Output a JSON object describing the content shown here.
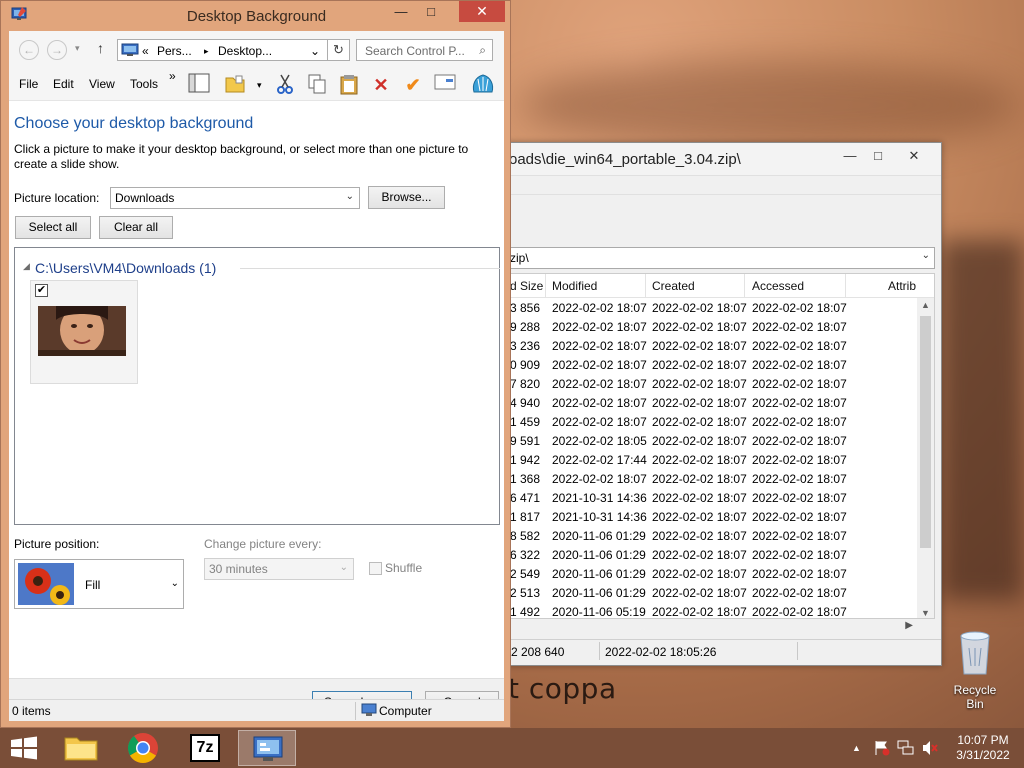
{
  "main_window": {
    "title": "Desktop Background",
    "controls": {
      "minimize": "—",
      "maximize": "□",
      "close": "✕"
    },
    "nav": {
      "back": "←",
      "forward": "→",
      "dropdown": "▾",
      "up": "↑",
      "breadcrumb_prefix": "«",
      "crumb_1": "Pers...",
      "crumb_sep": "▸",
      "crumb_2": "Desktop...",
      "addr_arrow": "⌄",
      "refresh": "↻",
      "search_placeholder": "Search Control P...",
      "search_icon": "⌕"
    },
    "menu": {
      "file": "File",
      "edit": "Edit",
      "view": "View",
      "tools": "Tools",
      "more": "»"
    },
    "heading": "Choose your desktop background",
    "description": "Click a picture to make it your desktop background, or select more than one picture to create a slide show.",
    "picture_location_label": "Picture location:",
    "picture_location_value": "Downloads",
    "browse_label": "Browse...",
    "select_all_label": "Select all",
    "clear_all_label": "Clear all",
    "group_header": "C:\\Users\\VM4\\Downloads (1)",
    "group_arrow": "◢",
    "tile_checked": "✔",
    "picture_position_label": "Picture position:",
    "picture_position_value": "Fill",
    "change_every_label": "Change picture every:",
    "change_every_value": "30 minutes",
    "shuffle_label": "Shuffle",
    "combo_arrow": "⌄",
    "save_label": "Save changes",
    "cancel_label": "Cancel",
    "status_items": "0 items",
    "status_location": "Computer"
  },
  "zip_window": {
    "title": "oads\\die_win64_portable_3.04.zip\\",
    "controls": {
      "minimize": "—",
      "maximize": "□",
      "close": "✕"
    },
    "address": "zip\\",
    "columns": [
      "d Size",
      "Modified",
      "Created",
      "Accessed",
      "Attrib"
    ],
    "rows": [
      [
        "3 856",
        "2022-02-02 18:07",
        "2022-02-02 18:07",
        "2022-02-02 18:07"
      ],
      [
        "9 288",
        "2022-02-02 18:07",
        "2022-02-02 18:07",
        "2022-02-02 18:07"
      ],
      [
        "3 236",
        "2022-02-02 18:07",
        "2022-02-02 18:07",
        "2022-02-02 18:07"
      ],
      [
        "0 909",
        "2022-02-02 18:07",
        "2022-02-02 18:07",
        "2022-02-02 18:07"
      ],
      [
        "7 820",
        "2022-02-02 18:07",
        "2022-02-02 18:07",
        "2022-02-02 18:07"
      ],
      [
        "4 940",
        "2022-02-02 18:07",
        "2022-02-02 18:07",
        "2022-02-02 18:07"
      ],
      [
        "1 459",
        "2022-02-02 18:07",
        "2022-02-02 18:07",
        "2022-02-02 18:07"
      ],
      [
        "9 591",
        "2022-02-02 18:05",
        "2022-02-02 18:07",
        "2022-02-02 18:07"
      ],
      [
        "1 942",
        "2022-02-02 17:44",
        "2022-02-02 18:07",
        "2022-02-02 18:07"
      ],
      [
        "1 368",
        "2022-02-02 18:07",
        "2022-02-02 18:07",
        "2022-02-02 18:07"
      ],
      [
        "6 471",
        "2021-10-31 14:36",
        "2022-02-02 18:07",
        "2022-02-02 18:07"
      ],
      [
        "1 817",
        "2021-10-31 14:36",
        "2022-02-02 18:07",
        "2022-02-02 18:07"
      ],
      [
        "8 582",
        "2020-11-06 01:29",
        "2022-02-02 18:07",
        "2022-02-02 18:07"
      ],
      [
        "6 322",
        "2020-11-06 01:29",
        "2022-02-02 18:07",
        "2022-02-02 18:07"
      ],
      [
        "2 549",
        "2020-11-06 01:29",
        "2022-02-02 18:07",
        "2022-02-02 18:07"
      ],
      [
        "2 513",
        "2020-11-06 01:29",
        "2022-02-02 18:07",
        "2022-02-02 18:07"
      ],
      [
        "1 492",
        "2020-11-06 05:19",
        "2022-02-02 18:07",
        "2022-02-02 18:07"
      ]
    ],
    "status_size": "2 208 640",
    "status_date": "2022-02-02 18:05:26",
    "scroll_up": "▲",
    "scroll_down": "▼",
    "scroll_right": "▶"
  },
  "wallpaper_caption": "t coppa",
  "desktop": {
    "recycle_bin": "Recycle Bin"
  },
  "taskbar": {
    "tray_chevron": "▲",
    "clock_time": "10:07 PM",
    "clock_date": "3/31/2022",
    "sevenzip_label": "7z"
  }
}
